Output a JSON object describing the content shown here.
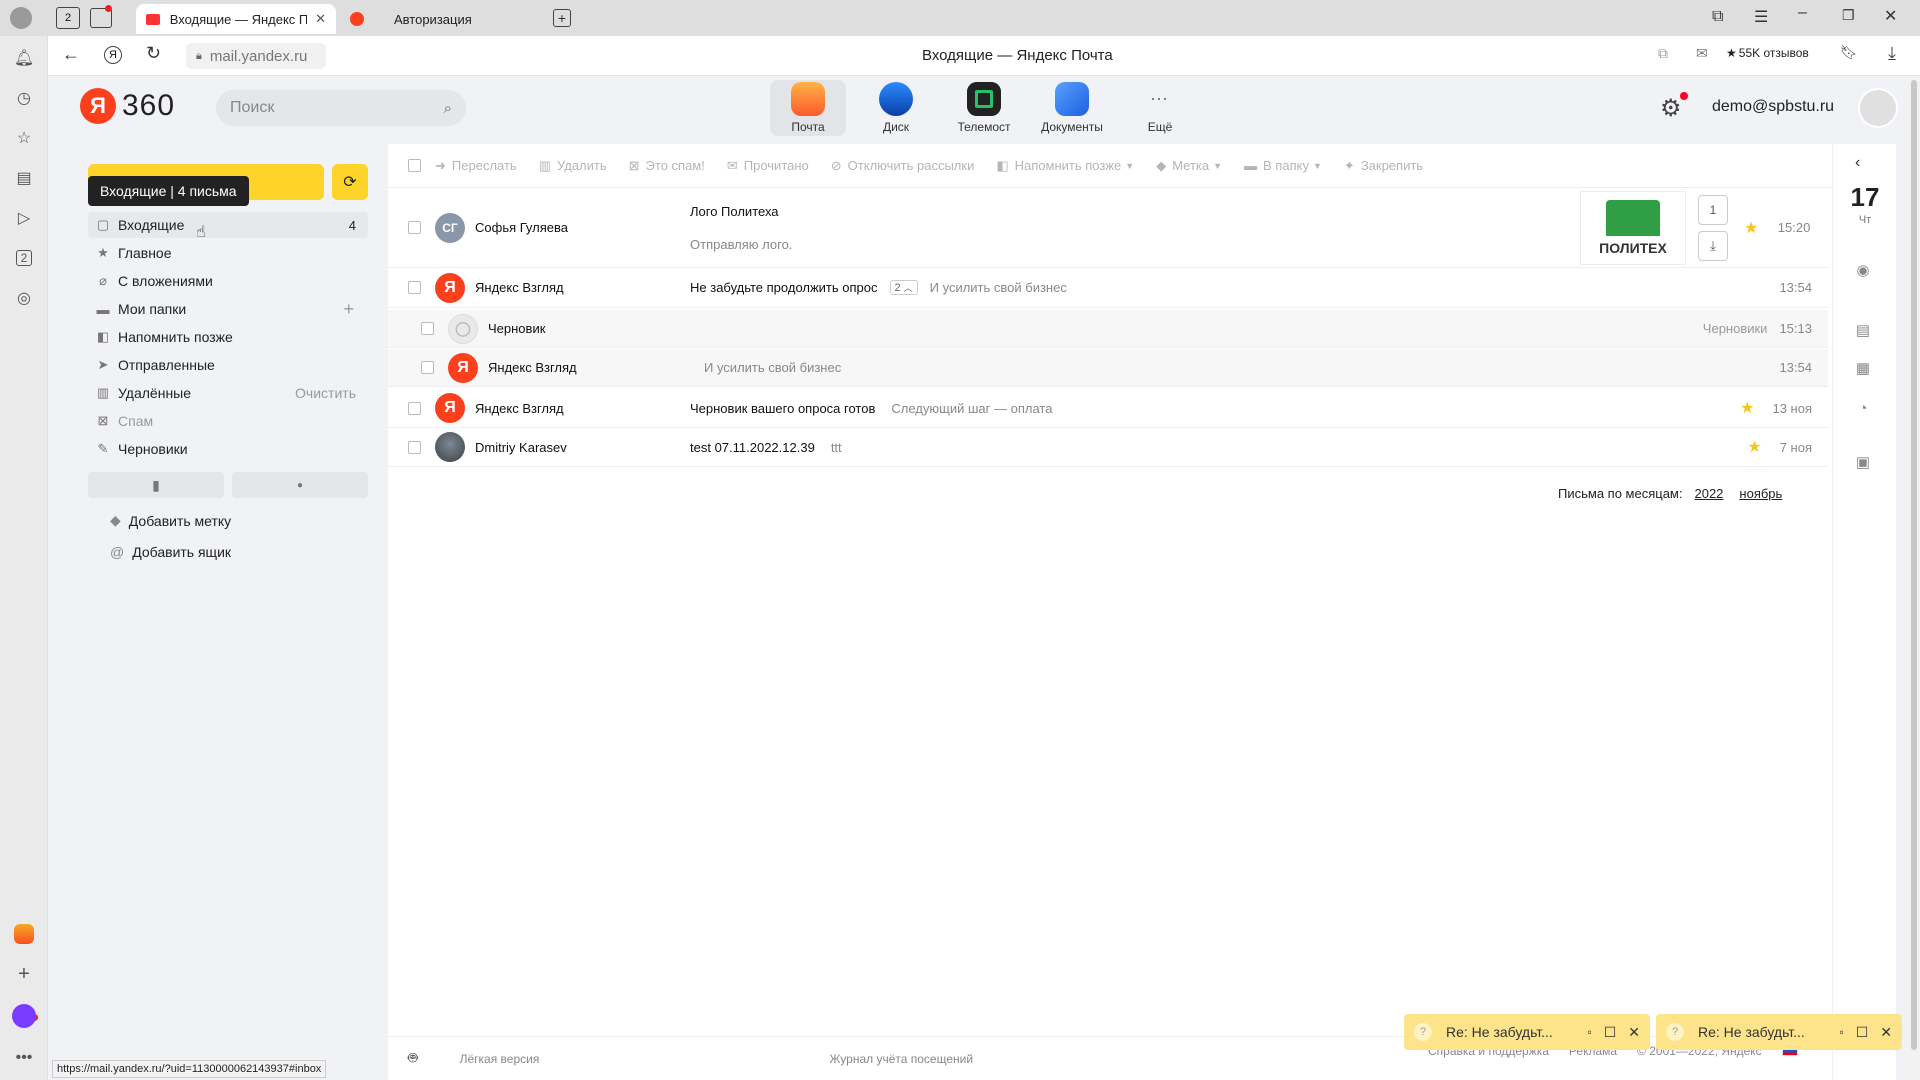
{
  "browser": {
    "tabs": [
      {
        "label": "Входящие — Яндекс П",
        "active": true
      },
      {
        "label": "Авторизация",
        "active": false
      }
    ],
    "tab_count_badge": "2",
    "url": "mail.yandex.ru",
    "page_title": "Входящие — Яндекс Почта",
    "reviews": "55K отзывов",
    "status_url": "https://mail.yandex.ru/?uid=1130000062143937#inbox"
  },
  "header": {
    "logo_ya": "Я",
    "logo_360": "360",
    "search_placeholder": "Поиск",
    "services": [
      {
        "label": "Почта",
        "icon": "mail-icon",
        "active": true
      },
      {
        "label": "Диск",
        "icon": "disk-icon"
      },
      {
        "label": "Телемост",
        "icon": "telemost-icon"
      },
      {
        "label": "Документы",
        "icon": "documents-icon"
      },
      {
        "label": "Ещё",
        "icon": "more-icon"
      }
    ],
    "user_email": "demo@spbstu.ru"
  },
  "sidebar": {
    "tooltip": "Входящие | 4 письма",
    "folders": [
      {
        "label": "Входящие",
        "count": "4",
        "icon": "inbox-icon"
      },
      {
        "label": "Главное",
        "icon": "star-icon"
      },
      {
        "label": "С вложениями",
        "icon": "paperclip-icon"
      },
      {
        "label": "Мои папки",
        "icon": "folder-icon",
        "action": "+"
      },
      {
        "label": "Напомнить позже",
        "icon": "reminder-icon"
      },
      {
        "label": "Отправленные",
        "icon": "send-icon"
      },
      {
        "label": "Удалённые",
        "icon": "trash-icon",
        "action": "Очистить"
      },
      {
        "label": "Спам",
        "icon": "spam-icon"
      },
      {
        "label": "Черновики",
        "icon": "draft-icon"
      }
    ],
    "add_label": "Добавить метку",
    "add_mailbox": "Добавить ящик"
  },
  "toolbar": {
    "actions": [
      "Переслать",
      "Удалить",
      "Это спам!",
      "Прочитано",
      "Отключить рассылки",
      "Напомнить позже",
      "Метка",
      "В папку",
      "Закрепить"
    ]
  },
  "messages": [
    {
      "sender": "Софья Гуляева",
      "initials": "СГ",
      "subject": "Лого Политеха",
      "snippet": "Отправляю лого.",
      "time": "15:20",
      "starred": true,
      "attachment_count": "1",
      "attachment_text": "ПОЛИТЕХ"
    },
    {
      "sender": "Яндекс Взгляд",
      "subject": "Не забудьте продолжить опрос",
      "thread_count": "2",
      "snippet": "И усилить свой бизнес",
      "time": "13:54"
    },
    {
      "sender": "Черновик",
      "subject": "",
      "snippet": "",
      "folder_tag": "Черновики",
      "time": "15:13"
    },
    {
      "sender": "Яндекс Взгляд",
      "subject": "",
      "snippet": "И усилить свой бизнес",
      "time": "13:54"
    },
    {
      "sender": "Яндекс Взгляд",
      "subject": "Черновик вашего опроса готов",
      "snippet": "Следующий шаг — оплата",
      "time": "13 ноя",
      "starred": true
    },
    {
      "sender": "Dmitriy Karasev",
      "subject": "test 07.11.2022.12.39",
      "snippet": "ttt",
      "time": "7 ноя",
      "starred": true
    }
  ],
  "archive": {
    "label": "Письма по месяцам:",
    "year": "2022",
    "month": "ноябрь"
  },
  "calendar": {
    "day": "17",
    "weekday": "Чт"
  },
  "footer": {
    "light_version": "Лёгкая версия",
    "visit_log": "Журнал учёта посещений",
    "help": "Справка и поддержка",
    "ads": "Реклама",
    "copyright": "© 2001—2022, Яндекс"
  },
  "drafts": [
    {
      "label": "Re: Не забудьт..."
    },
    {
      "label": "Re: Не забудьт..."
    }
  ],
  "colors": {
    "accent": "#fed42b",
    "yandex_red": "#fc3f1d",
    "star": "#f6c51f"
  }
}
